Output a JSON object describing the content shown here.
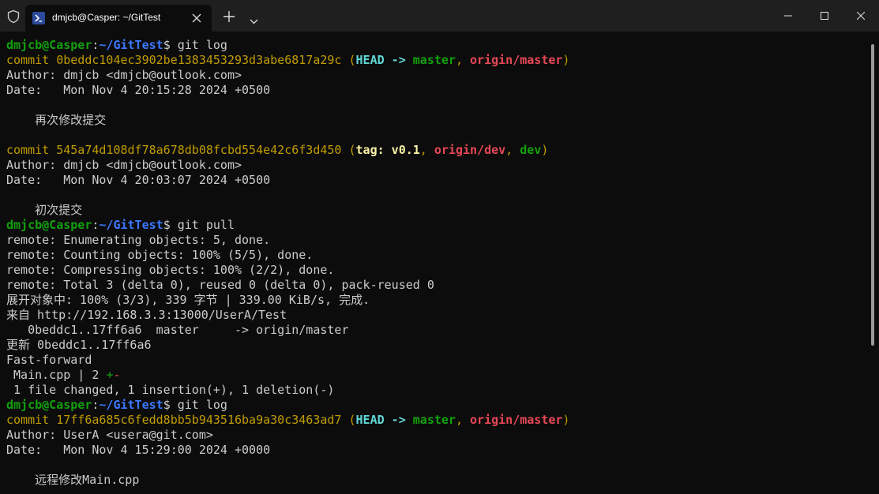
{
  "window": {
    "tab_title": "dmjcb@Casper: ~/GitTest",
    "tab_icon": "powershell-icon",
    "buttons": [
      "minimize-icon",
      "maximize-icon",
      "close-icon"
    ]
  },
  "colors": {
    "background": "#0c0c0c",
    "titlebar": "#1f1f1f",
    "prompt_user": "#13a10e",
    "prompt_path": "#3b78ff",
    "commit": "#c19c00",
    "head": "#61d6d6",
    "branch_local": "#13a10e",
    "branch_remote": "#e74856",
    "tag": "#f9f1a5",
    "text": "#cccccc"
  },
  "terminal": {
    "prompt": {
      "user_host": "dmjcb@Casper",
      "sep": ":",
      "path": "~/GitTest",
      "dollar": "$ "
    },
    "cmd1": "git log",
    "commit1": {
      "label": "commit ",
      "hash": "0beddc104ec3902be1383453293d3abe6817a29c",
      "open": " (",
      "head": "HEAD -> ",
      "master": "master",
      "comma1": ", ",
      "origin_master": "origin/master",
      "close": ")",
      "author": "Author: dmjcb <dmjcb@outlook.com>",
      "date": "Date:   Mon Nov 4 20:15:28 2024 +0500",
      "message": "    再次修改提交"
    },
    "commit2": {
      "label": "commit ",
      "hash": "545a74d108df78a678db08fcbd554e42c6f3d450",
      "open": " (",
      "tag": "tag: v0.1",
      "comma1": ", ",
      "origin_dev": "origin/dev",
      "comma2": ", ",
      "dev": "dev",
      "close": ")",
      "author": "Author: dmjcb <dmjcb@outlook.com>",
      "date": "Date:   Mon Nov 4 20:03:07 2024 +0500",
      "message": "    初次提交"
    },
    "cmd2": "git pull",
    "pull_output": [
      "remote: Enumerating objects: 5, done.",
      "remote: Counting objects: 100% (5/5), done.",
      "remote: Compressing objects: 100% (2/2), done.",
      "remote: Total 3 (delta 0), reused 0 (delta 0), pack-reused 0",
      "展开对象中: 100% (3/3), 339 字节 | 339.00 KiB/s, 完成.",
      "来自 http://192.168.3.3:13000/UserA/Test",
      "   0beddc1..17ff6a6  master     -> origin/master",
      "更新 0beddc1..17ff6a6",
      "Fast-forward"
    ],
    "diffstat": {
      "file": " Main.cpp | 2 ",
      "plus": "+",
      "minus": "-"
    },
    "summary": " 1 file changed, 1 insertion(+), 1 deletion(-)",
    "cmd3": "git log",
    "commit3": {
      "label": "commit ",
      "hash": "17ff6a685c6fedd8bb5b943516ba9a30c3463ad7",
      "open": " (",
      "head": "HEAD -> ",
      "master": "master",
      "comma1": ", ",
      "origin_master": "origin/master",
      "close": ")",
      "author": "Author: UserA <usera@git.com>",
      "date": "Date:   Mon Nov 4 15:29:00 2024 +0000",
      "message": "    远程修改Main.cpp"
    }
  }
}
